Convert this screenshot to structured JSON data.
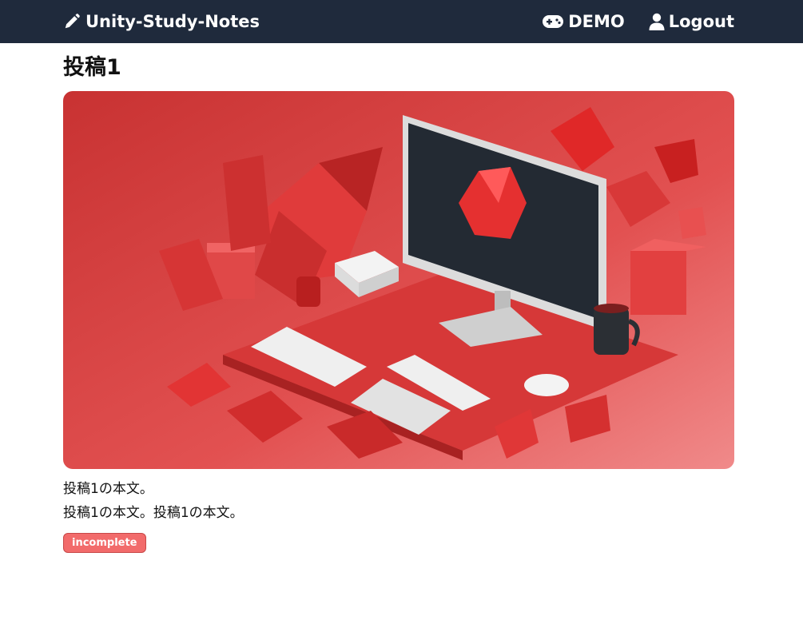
{
  "navbar": {
    "brand": "Unity-Study-Notes",
    "brand_icon": "pencil-icon",
    "links": [
      {
        "label": "DEMO",
        "icon": "gamepad-icon"
      },
      {
        "label": "Logout",
        "icon": "user-icon"
      }
    ]
  },
  "post": {
    "title": "投稿1",
    "body_lines": [
      "投稿1の本文。",
      "投稿1の本文。投稿1の本文。"
    ],
    "status": "incomplete"
  },
  "colors": {
    "navbar_bg": "#1f2a3c",
    "badge_bg": "#f26b6b",
    "hero_primary": "#d93a3a"
  }
}
